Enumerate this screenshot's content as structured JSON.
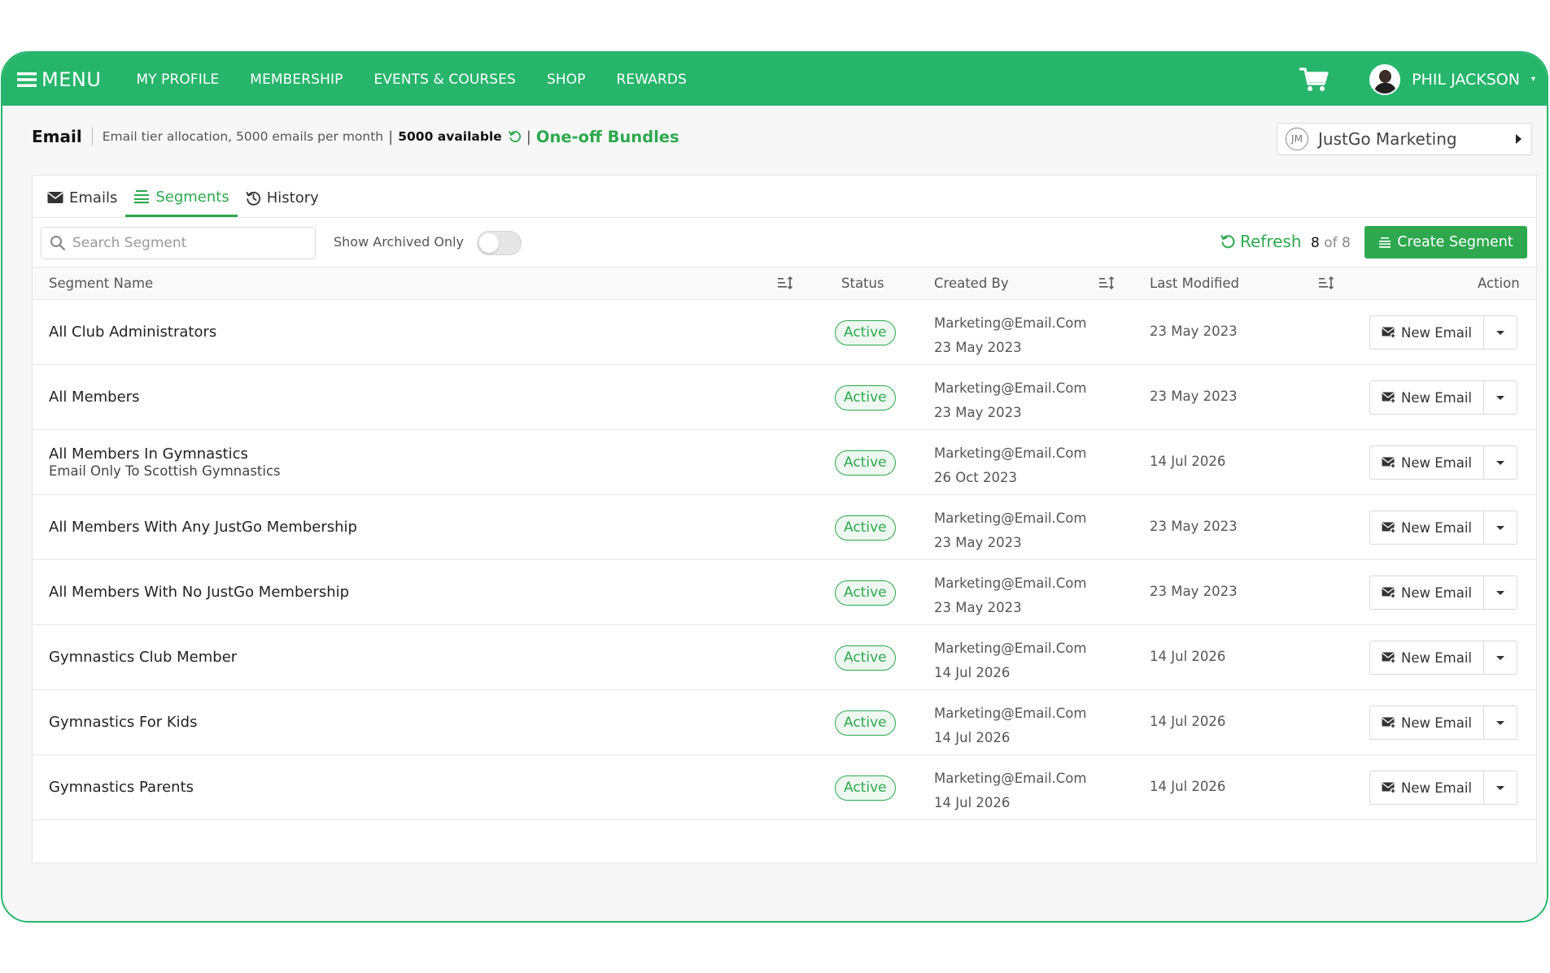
{
  "nav": {
    "menu_label": "MENU",
    "links": [
      "MY PROFILE",
      "MEMBERSHIP",
      "EVENTS & COURSES",
      "SHOP",
      "REWARDS"
    ],
    "user_name": "PHIL JACKSON"
  },
  "header": {
    "title": "Email",
    "tier_text": "Email tier allocation, 5000 emails per month",
    "available_text": "5000 available",
    "bundles_link": "One-off Bundles",
    "org_initials": "JM",
    "org_name": "JustGo Marketing"
  },
  "tabs": [
    {
      "label": "Emails",
      "icon": "envelope-icon",
      "active": false
    },
    {
      "label": "Segments",
      "icon": "segments-icon",
      "active": true
    },
    {
      "label": "History",
      "icon": "history-icon",
      "active": false
    }
  ],
  "toolbar": {
    "search_placeholder": "Search Segment",
    "archived_label": "Show Archived Only",
    "archived_on": false,
    "refresh_label": "Refresh",
    "count_current": "8",
    "count_total": "of 8",
    "create_label": "Create Segment"
  },
  "table": {
    "columns": {
      "name": "Segment Name",
      "status": "Status",
      "created_by": "Created By",
      "last_modified": "Last Modified",
      "action": "Action"
    },
    "action_label": "New Email",
    "rows": [
      {
        "name": "All Club Administrators",
        "sub": "",
        "status": "Active",
        "creator": "Marketing@Email.Com",
        "created": "23 May 2023",
        "modified": "23 May 2023"
      },
      {
        "name": "All Members",
        "sub": "",
        "status": "Active",
        "creator": "Marketing@Email.Com",
        "created": "23 May 2023",
        "modified": "23 May 2023"
      },
      {
        "name": "All Members In Gymnastics",
        "sub": "Email Only To Scottish Gymnastics",
        "status": "Active",
        "creator": "Marketing@Email.Com",
        "created": "26 Oct 2023",
        "modified": "14 Jul 2026"
      },
      {
        "name": "All Members With Any JustGo Membership",
        "sub": "",
        "status": "Active",
        "creator": "Marketing@Email.Com",
        "created": "23 May 2023",
        "modified": "23 May 2023"
      },
      {
        "name": "All Members With No JustGo Membership",
        "sub": "",
        "status": "Active",
        "creator": "Marketing@Email.Com",
        "created": "23 May 2023",
        "modified": "23 May 2023"
      },
      {
        "name": "Gymnastics Club Member",
        "sub": "",
        "status": "Active",
        "creator": "Marketing@Email.Com",
        "created": "14 Jul 2026",
        "modified": "14 Jul 2026"
      },
      {
        "name": "Gymnastics For Kids",
        "sub": "",
        "status": "Active",
        "creator": "Marketing@Email.Com",
        "created": "14 Jul 2026",
        "modified": "14 Jul 2026"
      },
      {
        "name": "Gymnastics Parents",
        "sub": "",
        "status": "Active",
        "creator": "Marketing@Email.Com",
        "created": "14 Jul 2026",
        "modified": "14 Jul 2026"
      }
    ]
  },
  "colors": {
    "brand_green": "#27b56b",
    "accent_green": "#2ea84f"
  }
}
